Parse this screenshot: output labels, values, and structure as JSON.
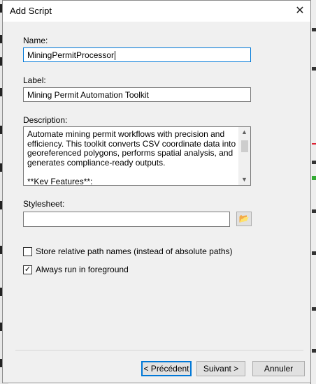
{
  "window": {
    "title": "Add Script",
    "close_symbol": "✕"
  },
  "name": {
    "label": "Name:",
    "value": "MiningPermitProcessor"
  },
  "label_field": {
    "label": "Label:",
    "value": "Mining Permit Automation Toolkit"
  },
  "description": {
    "label": "Description:",
    "value": "Automate mining permit workflows with precision and efficiency. This toolkit converts CSV coordinate data into georeferenced polygons, performs spatial analysis, and generates compliance-ready outputs.\n\n**Key Features**:"
  },
  "stylesheet": {
    "label": "Stylesheet:",
    "value": ""
  },
  "options": {
    "relative_paths": {
      "label": "Store relative path names (instead of absolute paths)",
      "checked": false
    },
    "foreground": {
      "label": "Always run in foreground",
      "checked": true
    }
  },
  "buttons": {
    "back": "< Précédent",
    "next": "Suivant >",
    "cancel": "Annuler"
  },
  "icons": {
    "browse": "folder-open-icon",
    "close": "close-icon",
    "scroll_up": "chevron-up-icon",
    "scroll_down": "chevron-down-icon"
  },
  "colors": {
    "accent": "#0078d7",
    "dialog_bg": "#f0f0f0"
  }
}
